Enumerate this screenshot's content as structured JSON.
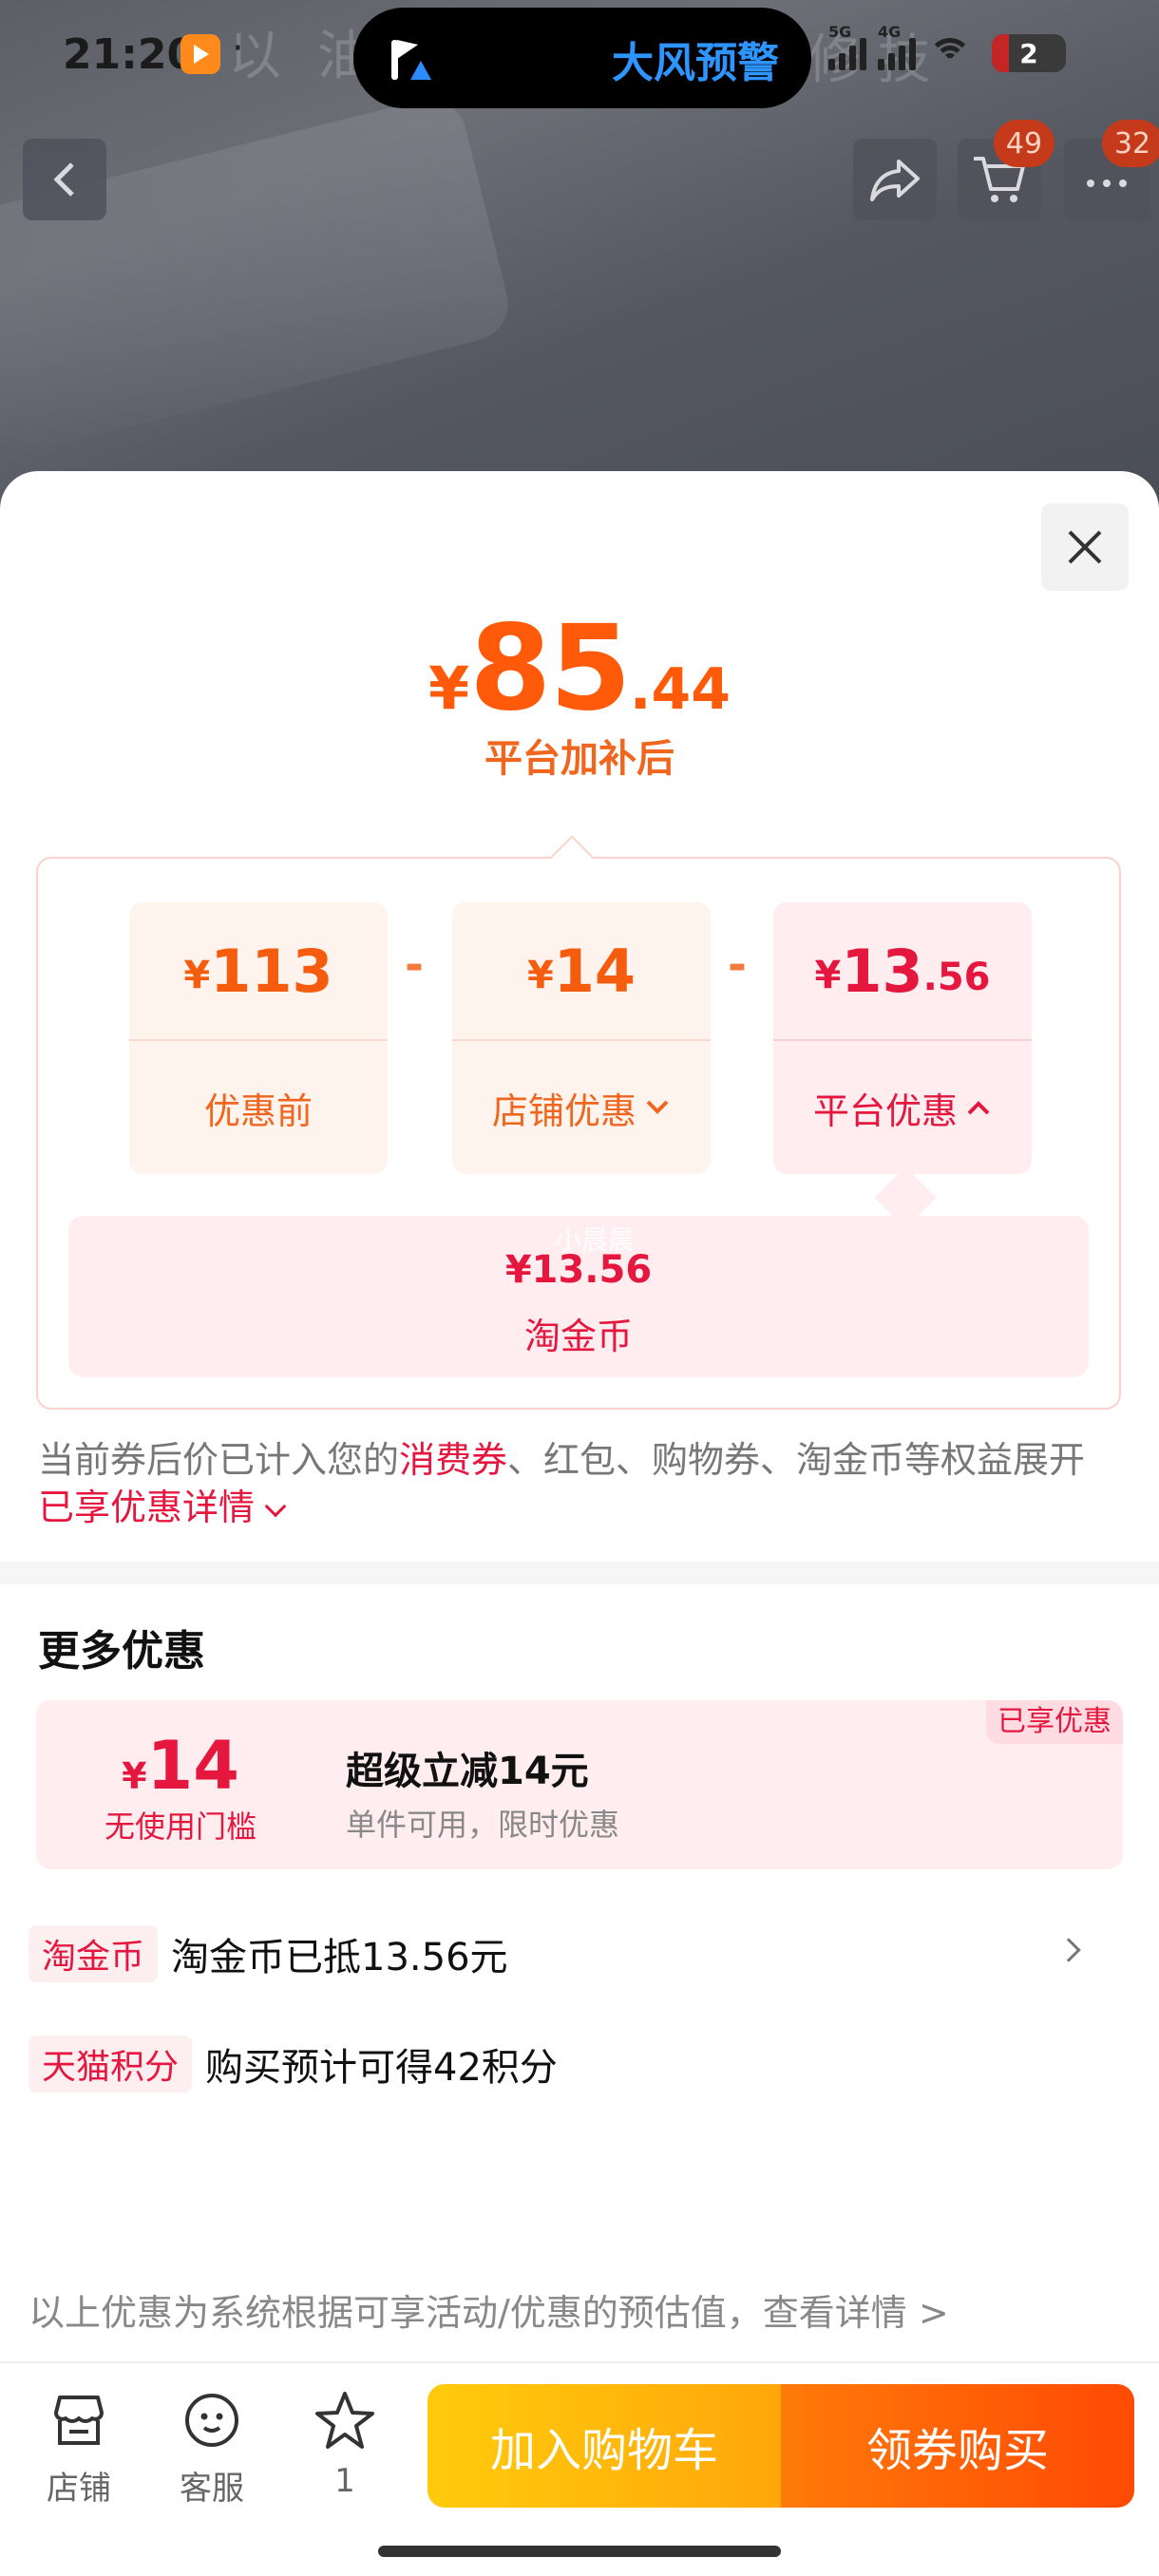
{
  "status_bar": {
    "time": "21:20",
    "dots": "·",
    "alert_text": "大风预警",
    "net1": "5G",
    "net2": "4G",
    "battery": "2"
  },
  "background_text": {
    "left": "以 油",
    "right": "修 技"
  },
  "nav": {
    "cart_badge": "49",
    "more_badge": "32"
  },
  "price": {
    "yen": "¥",
    "integer": "85",
    "decimal": ".44",
    "subtitle": "平台加补后"
  },
  "breakdown": {
    "before": {
      "yen": "¥",
      "integer": "113",
      "decimal": "",
      "label": "优惠前"
    },
    "shop": {
      "yen": "¥",
      "integer": "14",
      "decimal": "",
      "label": "店铺优惠"
    },
    "platform": {
      "yen": "¥",
      "integer": "13",
      "decimal": ".56",
      "label": "平台优惠"
    },
    "minus": "-",
    "sub_item": {
      "watermark": "小晨晨",
      "amount": "¥13.56",
      "label": "淘金币"
    }
  },
  "note": {
    "part1": "当前券后价已计入您的",
    "highlight1": "消费券",
    "part2": "、红包、购物券、淘金币等权益展开",
    "highlight2": "已享优惠详情"
  },
  "more": {
    "title": "更多优惠",
    "coupon": {
      "yen": "¥",
      "amount": "14",
      "condition": "无使用门槛",
      "title": "超级立减14元",
      "desc": "单件可用，限时优惠",
      "tag": "已享优惠"
    },
    "rows": [
      {
        "chip": "淘金币",
        "text": "淘金币已抵13.56元"
      },
      {
        "chip": "天猫积分",
        "text": "购买预计可得42积分"
      }
    ],
    "disclaimer": "以上优惠为系统根据可享活动/优惠的预估值，查看详情 >"
  },
  "bottom_bar": {
    "tabs": [
      {
        "label": "店铺",
        "icon": "store-icon"
      },
      {
        "label": "客服",
        "icon": "customer-service-icon"
      },
      {
        "label": "1",
        "icon": "star-icon"
      }
    ],
    "add_to_cart": "加入购物车",
    "buy": "领券购买"
  },
  "colors": {
    "price_orange": "#ff5a0a",
    "platform_red": "#e5173f",
    "cart_button": "#ffb30b",
    "buy_button": "#ff5a06"
  }
}
